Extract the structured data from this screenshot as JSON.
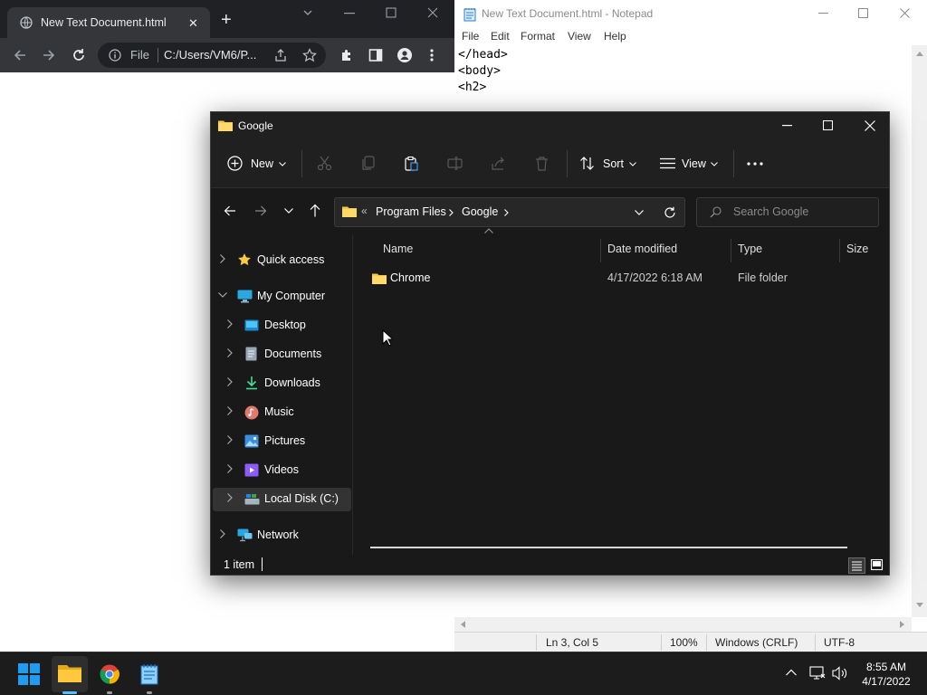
{
  "chrome": {
    "tab_title": "New Text Document.html",
    "omnibox_scheme": "File",
    "omnibox_url": "C:/Users/VM6/P..."
  },
  "notepad": {
    "title": "New Text Document.html - Notepad",
    "menu": [
      "File",
      "Edit",
      "Format",
      "View",
      "Help"
    ],
    "content": "</head>\n<body>\n<h2>",
    "status": {
      "position": "Ln 3, Col 5",
      "zoom": "100%",
      "line_ending": "Windows (CRLF)",
      "encoding": "UTF-8"
    }
  },
  "explorer": {
    "title": "Google",
    "command_bar": {
      "new_label": "New",
      "sort_label": "Sort",
      "view_label": "View"
    },
    "breadcrumb": [
      "Program Files",
      "Google"
    ],
    "search_placeholder": "Search Google",
    "nav_items": [
      {
        "label": "Quick access",
        "icon": "star-icon"
      },
      {
        "label": "My Computer",
        "icon": "computer-icon"
      },
      {
        "label": "Desktop",
        "icon": "desktop-icon"
      },
      {
        "label": "Documents",
        "icon": "documents-icon"
      },
      {
        "label": "Downloads",
        "icon": "downloads-icon"
      },
      {
        "label": "Music",
        "icon": "music-icon"
      },
      {
        "label": "Pictures",
        "icon": "pictures-icon"
      },
      {
        "label": "Videos",
        "icon": "videos-icon"
      },
      {
        "label": "Local Disk (C:)",
        "icon": "drive-icon"
      },
      {
        "label": "Network",
        "icon": "network-icon"
      }
    ],
    "columns": [
      "Name",
      "Date modified",
      "Type",
      "Size"
    ],
    "files": [
      {
        "name": "Chrome",
        "date_modified": "4/17/2022 6:18 AM",
        "type": "File folder",
        "size": ""
      }
    ],
    "status_text": "1 item"
  },
  "taskbar": {
    "time": "8:55 AM",
    "date": "4/17/2022"
  },
  "colors": {
    "explorer_bg": "#191919",
    "folder_yellow": "#f8c846",
    "accent_blue": "#0078d4",
    "taskbar_bg": "#1c1c1c"
  }
}
